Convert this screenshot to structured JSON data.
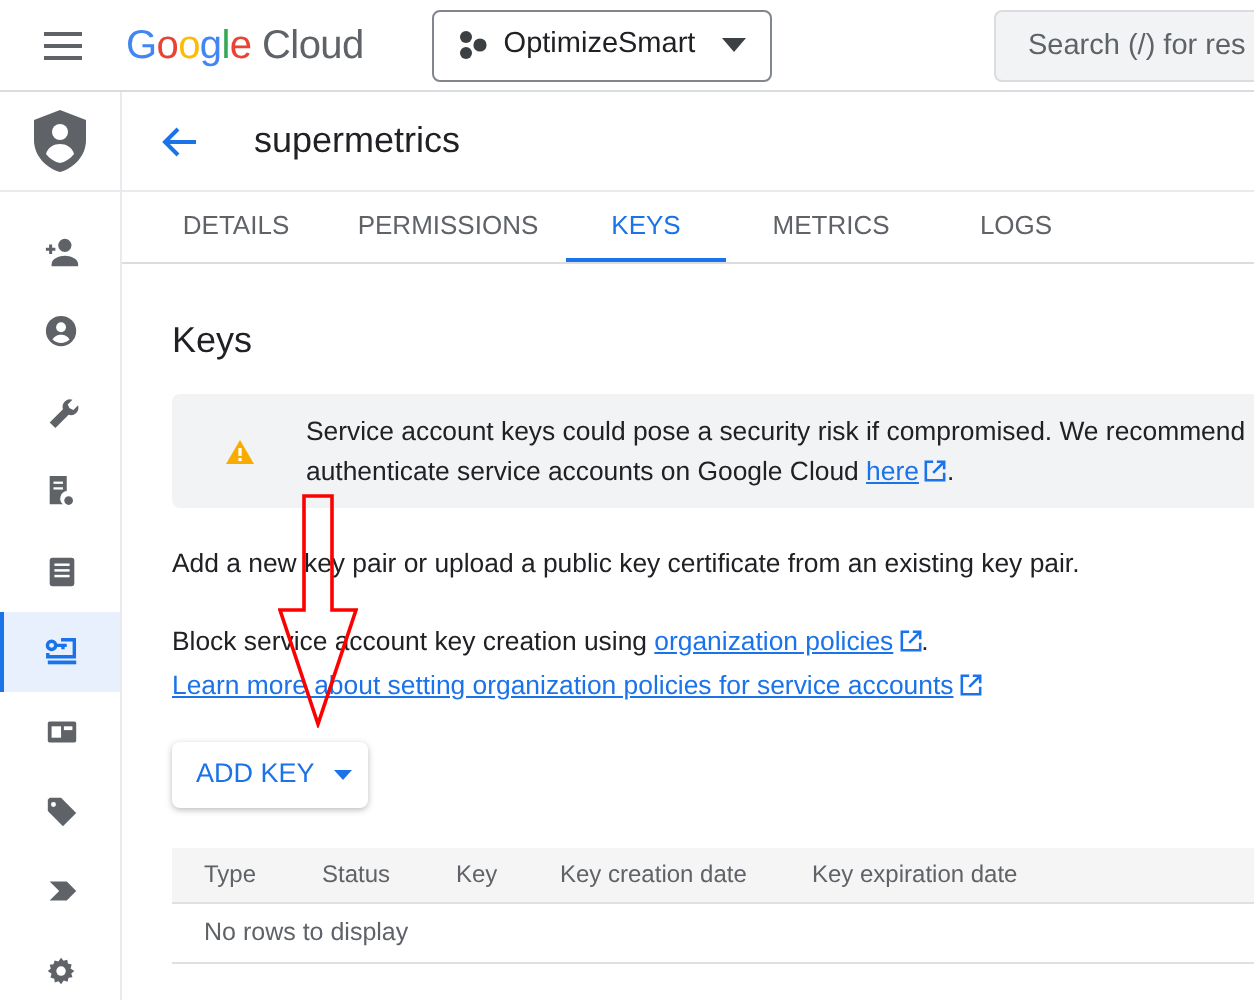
{
  "header": {
    "logo": "Google Cloud",
    "project": "OptimizeSmart",
    "search": {
      "placeholder": "Search (/) for res"
    }
  },
  "sidebar": {
    "items": [
      {
        "selected": false
      },
      {
        "selected": false
      },
      {
        "selected": false
      },
      {
        "selected": false
      },
      {
        "selected": false
      },
      {
        "selected": true
      },
      {
        "selected": false
      },
      {
        "selected": false
      },
      {
        "selected": false
      },
      {
        "selected": false
      }
    ]
  },
  "page": {
    "title": "supermetrics"
  },
  "tabs": [
    {
      "label": "DETAILS",
      "selected": false
    },
    {
      "label": "PERMISSIONS",
      "selected": false
    },
    {
      "label": "KEYS",
      "selected": true
    },
    {
      "label": "METRICS",
      "selected": false
    },
    {
      "label": "LOGS",
      "selected": false
    }
  ],
  "section": {
    "heading": "Keys",
    "warning": {
      "line_1": "Service account keys could pose a security risk if compromised. We recommend",
      "line_2": "authenticate service accounts on Google Cloud ",
      "link": "here",
      "end": "."
    },
    "intro": "Add a new key pair or upload a public key certificate from an existing key pair.",
    "policy": {
      "text": "Block service account key creation using ",
      "link": "organization policies",
      "end": "."
    },
    "learn_more": "Learn more about setting organization policies for service accounts",
    "add_key_button": "ADD KEY"
  },
  "table": {
    "columns": [
      "Type",
      "Status",
      "Key",
      "Key creation date",
      "Key expiration date"
    ],
    "empty_message": "No rows to display"
  }
}
